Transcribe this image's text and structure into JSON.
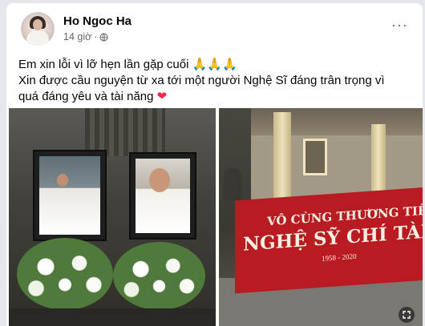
{
  "post": {
    "author": "Ho Ngoc Ha",
    "time": "14 giờ",
    "separator": "·",
    "more": "···",
    "lines": [
      "Em xin lỗi vì lỡ hẹn lần gặp cuối 🙏🙏🙏",
      "Xin được cầu nguyện từ xa tới một người Nghệ Sĩ đáng trân trọng vì",
      "quá đáng yêu và tài năng"
    ],
    "heart": "❤"
  },
  "photos": {
    "banner_line1": "VÔ CÙNG THƯƠNG TIẾC",
    "banner_line2": "NGHỆ SỸ CHÍ TÀI",
    "banner_years": "1958 - 2020"
  },
  "colors": {
    "heart": "#f02849",
    "banner": "#b81c22",
    "text": "#050505",
    "meta": "#65676b"
  }
}
